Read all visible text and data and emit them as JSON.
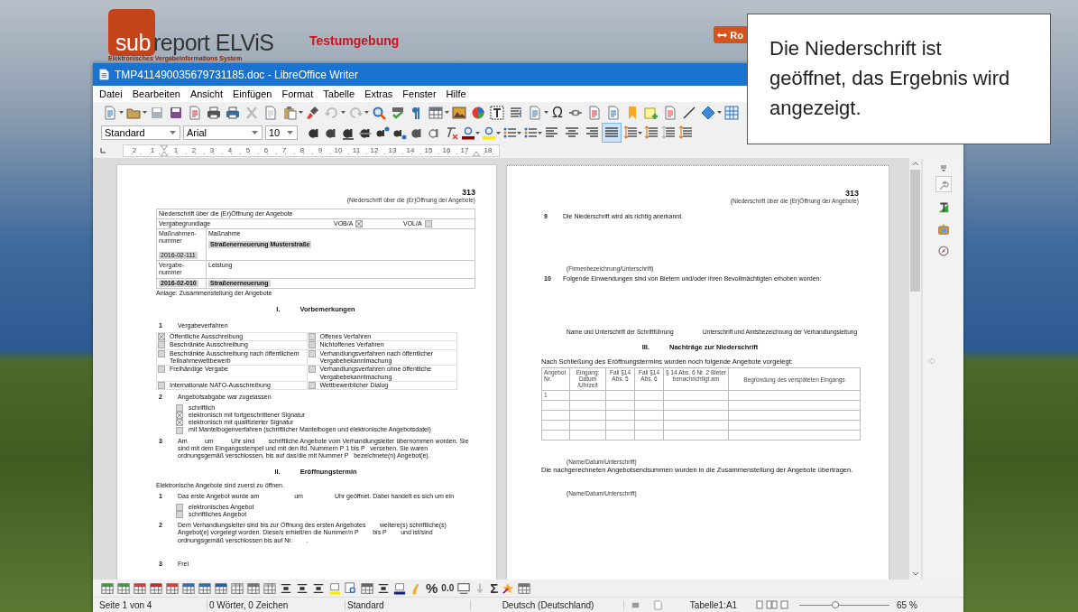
{
  "site": {
    "logo_prefix": "sub",
    "logo_name": "report ELViS",
    "logo_subtitle": "Elektronisches Vergabeinformations System",
    "environment": "Testumgebung",
    "button": "Ro"
  },
  "callout": {
    "text": "Die Niederschrift ist geöffnet, das Ergebnis wird angezeigt."
  },
  "window": {
    "title": "TMP411490035679731185.doc - LibreOffice Writer"
  },
  "menu": [
    "Datei",
    "Bearbeiten",
    "Ansicht",
    "Einfügen",
    "Format",
    "Tabelle",
    "Extras",
    "Fenster",
    "Hilfe"
  ],
  "standard_toolbar": {
    "special_character": "Ω"
  },
  "formatting_toolbar": {
    "paragraph_style": "Standard",
    "font_name": "Arial",
    "font_size": "10",
    "alignment_buttons": [
      {
        "selected": false
      },
      {
        "selected": false
      },
      {
        "selected": false
      },
      {
        "selected": true
      }
    ]
  },
  "ruler": {
    "left_labels": [
      "2",
      "1"
    ],
    "right_labels": [
      "1",
      "2",
      "3",
      "4",
      "5",
      "6",
      "7",
      "8",
      "9",
      "10",
      "11",
      "12",
      "13",
      "14",
      "15",
      "16",
      "17"
    ],
    "end_label": "18"
  },
  "pages": [
    {
      "header_number": "313",
      "header_title": "(Niederschrift über die (Er)Öffnung der Angebote)",
      "blocks": [
        {
          "kind": "form_table",
          "title": "Niederschrift über die (Er)Öffnung der Angebote",
          "basis_label": "Vergabegrundlage",
          "options": [
            {
              "label": "VOB/A",
              "checked": true
            },
            {
              "label": "VOL/A",
              "checked": false
            }
          ],
          "measure_number_label": "Maßnahmen-nummer",
          "measure_number": "2016-02-111",
          "measure_label": "Maßnahme",
          "measure": "Straßenerneuerung Musterstraße",
          "award_number_label": "Vergabe-nummer",
          "service_label": "Leistung",
          "award_number": "2016-02-010",
          "service": "Straßenerneuerung"
        },
        {
          "kind": "note",
          "text": "Anlage: Zusammenstellung der Angebote"
        },
        {
          "kind": "heading",
          "number": "I.",
          "text": "Vorbemerkungen"
        },
        {
          "kind": "numbered",
          "number": "1",
          "text": "Vergabeverfahren"
        },
        {
          "kind": "options_grid",
          "rows": [
            {
              "left": {
                "label": "Öffentliche Ausschreibung",
                "checked": true
              },
              "right": {
                "label": "Offenes Verfahren",
                "checked": false
              }
            },
            {
              "left": {
                "label": "Beschränkte Ausschreibung",
                "checked": false
              },
              "right": {
                "label": "Nichtoffenes Verfahren",
                "checked": false
              }
            },
            {
              "left": {
                "label": "Beschränkte Ausschreibung nach öffentlichem Teilnahmewettbewerb",
                "checked": false
              },
              "right": {
                "label": "Verhandlungsverfahren nach öffentlicher Vergabebekanntmachung",
                "checked": false
              }
            },
            {
              "left": {
                "label": "Freihändige Vergabe",
                "checked": false
              },
              "right": {
                "label": "Verhandlungsverfahren ohne öffentliche Vergabebekanntmachung",
                "checked": false
              }
            },
            {
              "left": {
                "label": "Internationale NATO-Ausschreibung",
                "checked": false
              },
              "right": {
                "label": "Wettbewerblicher Dialog",
                "checked": false
              }
            }
          ]
        },
        {
          "kind": "numbered",
          "number": "2",
          "text": "Angebotsabgabe war zugelassen"
        },
        {
          "kind": "checklist",
          "items": [
            {
              "label": "schriftlich",
              "checked": false
            },
            {
              "label": "elektronisch mit fortgeschrittener Signatur",
              "checked": true
            },
            {
              "label": "elektronisch mit qualifizierter Signatur",
              "checked": true
            },
            {
              "label": "mit Mantelbogenverfahren (schriftlicher Mantelbogen und elektronische Angebotsdatei)",
              "checked": false
            }
          ]
        },
        {
          "kind": "numbered",
          "number": "3",
          "text": "Am          um          Uhr sind        schriftliche Angebote vom Verhandlungsleiter übernommen worden. Sie sind mit dem Eingangsstempel und mit den lfd. Nummern P 1 bis P   versehen. Sie waren ordnungsgemäß verschlossen, bis auf das/die mit Nummer P   bezeichnete(n) Angebot(e)."
        },
        {
          "kind": "heading",
          "number": "II.",
          "text": "Eröffnungstermin"
        },
        {
          "kind": "note",
          "text": "Elektronische Angebote sind zuerst zu öffnen."
        },
        {
          "kind": "numbered",
          "number": "1",
          "text": "Das erste Angebot wurde am                    um                  Uhr geöffnet. Dabei handelt es sich um ein"
        },
        {
          "kind": "checklist",
          "items": [
            {
              "label": "elektronisches Angebot",
              "checked": false
            },
            {
              "label": "schriftliches Angebot",
              "checked": false
            }
          ]
        },
        {
          "kind": "numbered",
          "number": "2",
          "text": "Dem Verhandlungsleiter sind bis zur Öffnung des ersten Angebotes        weitere(s) schriftliche(s) Angebot(e) vorgelegt worden. Diese/s erhielt/en die Nummer/n P        bis P        und ist/sind ordnungsgemäß verschlossen bis auf Nr.        ."
        },
        {
          "kind": "numbered",
          "number": "3",
          "text": "Frei"
        }
      ]
    },
    {
      "header_number": "313",
      "header_title": "(Niederschrift über die (Er)Öffnung der Angebote)",
      "blocks": [
        {
          "kind": "numbered",
          "number": "9",
          "text": "Die Niederschrift wird als richtig anerkannt."
        },
        {
          "kind": "caption",
          "text": "(Firmenbezeichnung/Unterschrift)"
        },
        {
          "kind": "numbered",
          "number": "10",
          "text": "Folgende Einwendungen sind von Bietern und/oder ihren Bevollmächtigten erhoben worden:"
        },
        {
          "kind": "signatures",
          "left": "Name und Unterschrift der Schriftführung",
          "right": "Unterschrift und Amtsbezeichnung der Verhandlungsleitung"
        },
        {
          "kind": "heading",
          "number": "III.",
          "text": "Nachträge zur Niederschrift"
        },
        {
          "kind": "note",
          "text": "Nach Schließung des Eröffnungstermins wurden noch folgende Angebote vorgelegt:"
        },
        {
          "kind": "late_table",
          "columns": [
            "Angebot Nr.",
            "Eingang: Datum /Uhrzeit",
            "Fall §14 Abs. 5",
            "Fall §14 Abs. 6",
            "§ 14 Abs. 6 Nr. 2 Bieter benachrichtigt am",
            "Begründung des verspäteten Eingangs"
          ],
          "rows": [
            {
              "offer": "1"
            },
            {},
            {},
            {},
            {}
          ]
        },
        {
          "kind": "caption",
          "text": "(Name/Datum/Unterschrift)"
        },
        {
          "kind": "note",
          "text": "Die nachgerechneten Angebotsendsummen wurden in die Zusammenstellung der Angebote übertragen."
        },
        {
          "kind": "caption",
          "text": "(Name/Datum/Unterschrift)"
        }
      ]
    }
  ],
  "sidebar": {
    "tabs": [
      {
        "selected": true
      },
      {
        "selected": false
      },
      {
        "selected": false
      },
      {
        "selected": false
      }
    ]
  },
  "table_toolbar": {
    "percent": "%",
    "decimal": "0.0",
    "sum": "Σ"
  },
  "status_bar": {
    "page": "Seite 1 von 4",
    "words": "0 Wörter, 0 Zeichen",
    "page_style": "Standard",
    "language": "Deutsch (Deutschland)",
    "cell": "Tabelle1:A1",
    "zoom_slider": {
      "level": 0.4
    },
    "zoom": "65 %"
  }
}
